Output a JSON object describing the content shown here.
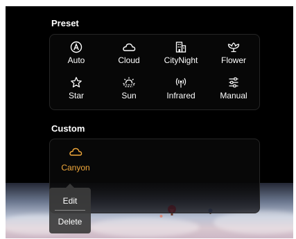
{
  "preset": {
    "title": "Preset",
    "items": [
      {
        "label": "Auto",
        "icon": "auto-a-icon"
      },
      {
        "label": "Cloud",
        "icon": "cloud-icon"
      },
      {
        "label": "CityNight",
        "icon": "city-building-icon"
      },
      {
        "label": "Flower",
        "icon": "flower-icon"
      },
      {
        "label": "Star",
        "icon": "star-icon"
      },
      {
        "label": "Sun",
        "icon": "sunrise-icon"
      },
      {
        "label": "Infrared",
        "icon": "infrared-signal-icon"
      },
      {
        "label": "Manual",
        "icon": "sliders-icon"
      }
    ]
  },
  "custom": {
    "title": "Custom",
    "items": [
      {
        "label": "Canyon",
        "icon": "cloud-icon",
        "selected": true
      }
    ]
  },
  "context_menu": {
    "items": [
      {
        "label": "Edit"
      },
      {
        "label": "Delete"
      }
    ]
  },
  "colors": {
    "accent": "#f2a93b",
    "text": "#ffffff",
    "background": "#000000",
    "menu_bg": "#3c3c3c"
  }
}
